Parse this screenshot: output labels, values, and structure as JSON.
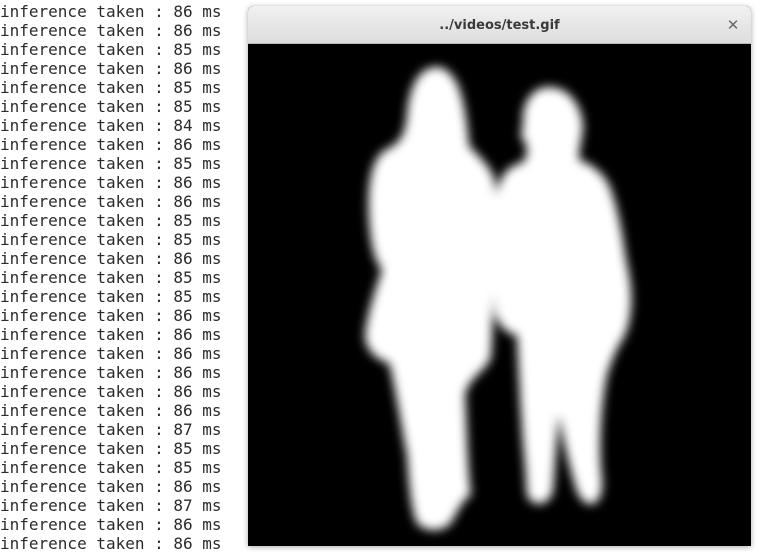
{
  "terminal": {
    "lines": [
      "inference taken : 86 ms",
      "inference taken : 86 ms",
      "inference taken : 85 ms",
      "inference taken : 86 ms",
      "inference taken : 85 ms",
      "inference taken : 85 ms",
      "inference taken : 84 ms",
      "inference taken : 86 ms",
      "inference taken : 85 ms",
      "inference taken : 86 ms",
      "inference taken : 86 ms",
      "inference taken : 85 ms",
      "inference taken : 85 ms",
      "inference taken : 86 ms",
      "inference taken : 85 ms",
      "inference taken : 85 ms",
      "inference taken : 86 ms",
      "inference taken : 86 ms",
      "inference taken : 86 ms",
      "inference taken : 86 ms",
      "inference taken : 86 ms",
      "inference taken : 86 ms",
      "inference taken : 87 ms",
      "inference taken : 85 ms",
      "inference taken : 85 ms",
      "inference taken : 86 ms",
      "inference taken : 87 ms",
      "inference taken : 86 ms",
      "inference taken : 86 ms"
    ]
  },
  "viewer": {
    "title": "../videos/test.gif",
    "close_icon": "close-icon",
    "close_glyph": "✕",
    "mask_colors": {
      "background": "#000000",
      "foreground": "#ffffff"
    }
  }
}
